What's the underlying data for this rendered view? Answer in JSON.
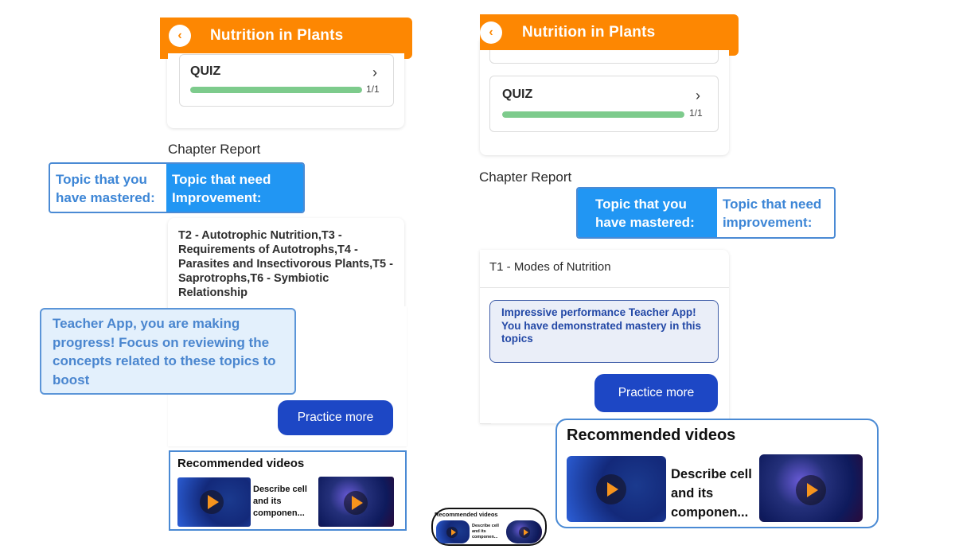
{
  "colors": {
    "header": "#fd8702",
    "accent_blue": "#2196f3",
    "button_blue": "#1d47c5",
    "progress_green": "#7dcb8c"
  },
  "left_screen": {
    "header": {
      "back_icon": "chevron-left-icon",
      "title": "Nutrition in Plants"
    },
    "quiz": {
      "label": "QUIZ",
      "chevron_icon": "chevron-right-icon",
      "progress_fraction": 1.0,
      "progress_text": "1/1"
    },
    "chapter_report": "Chapter Report",
    "toggle": {
      "mastered": "Topic that you have mastered:",
      "improvement": "Topic that need Improvement:",
      "active": "improvement"
    },
    "topics": "T2 - Autotrophic Nutrition,T3 - Requirements of Autotrophs,T4 - Parasites and Insectivorous Plants,T5 - Saprotrophs,T6 - Symbiotic Relationship",
    "message": "Teacher App, you are making progress! Focus on reviewing the concepts related to these topics to boost",
    "practice_button": "Practice more",
    "recommended": {
      "title": "Recommended videos",
      "videos": [
        {
          "thumbnail": "neuron-video-thumbnail",
          "title": "Describe cell and its componen..."
        },
        {
          "thumbnail": "brain-video-thumbnail",
          "title": ""
        }
      ]
    }
  },
  "middle_preview": {
    "title": "Recommended videos",
    "video_title": "Describe cell and its componen..."
  },
  "right_screen": {
    "header": {
      "back_icon": "chevron-left-icon",
      "title": "Nutrition in Plants"
    },
    "quiz": {
      "label": "QUIZ",
      "chevron_icon": "chevron-right-icon",
      "progress_fraction": 1.0,
      "progress_text": "1/1"
    },
    "chapter_report": "Chapter Report",
    "toggle": {
      "mastered": "Topic that you have mastered:",
      "improvement": "Topic that need improvement:",
      "active": "mastered"
    },
    "topics": "T1 - Modes of Nutrition",
    "message": "Impressive performance Teacher App! You have demonstrated mastery in this topics",
    "practice_button": "Practice more",
    "recommended": {
      "title": "Recommended videos",
      "videos": [
        {
          "thumbnail": "neuron-video-thumbnail",
          "title": "Describe cell and its componen..."
        },
        {
          "thumbnail": "brain-video-thumbnail",
          "title": ""
        }
      ]
    }
  }
}
